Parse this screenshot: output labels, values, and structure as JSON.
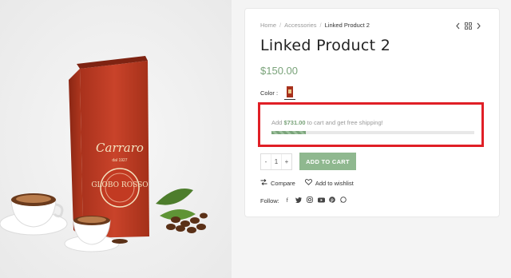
{
  "breadcrumb": {
    "home": "Home",
    "sep": "/",
    "category": "Accessories",
    "current": "Linked Product 2"
  },
  "product": {
    "title": "Linked Product 2",
    "price": "$150.00",
    "color_label": "Color :",
    "image": {
      "brand": "Carraro",
      "since": "dal 1927",
      "name": "GLOBO ROSSO"
    }
  },
  "shipping": {
    "prefix": "Add",
    "amount": "$731.00",
    "suffix": "to cart and get free shipping!",
    "progress": 0.17
  },
  "cart": {
    "qty_minus": "-",
    "qty_value": "1",
    "qty_plus": "+",
    "add_label": "ADD TO CART"
  },
  "actions": {
    "compare": "Compare",
    "wishlist": "Add to wishlist"
  },
  "follow": {
    "label": "Follow:",
    "icons": [
      "facebook-icon",
      "twitter-icon",
      "instagram-icon",
      "youtube-icon",
      "pinterest-icon",
      "whatsapp-icon"
    ]
  },
  "colors": {
    "accent": "#7aa37a",
    "highlight": "#e01f26"
  }
}
